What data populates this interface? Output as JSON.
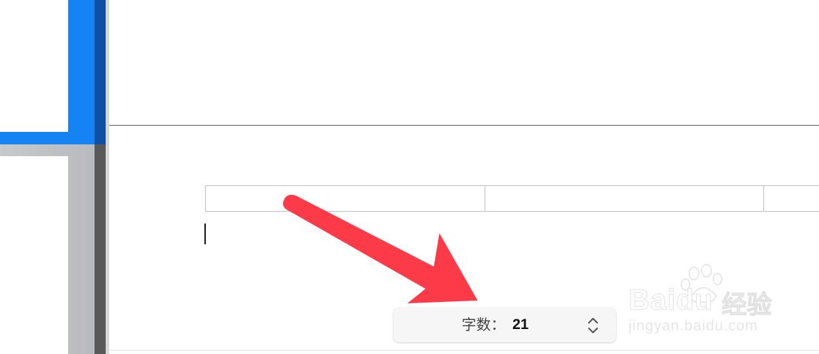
{
  "word_count": {
    "label": "字数：",
    "value": "21",
    "stepper_icon": "chevron-up-down-icon"
  },
  "watermark": {
    "brand": "Baidu",
    "cn": "经验",
    "url": "jingyan.baidu.com"
  },
  "colors": {
    "annotation_arrow": "#fc3a48",
    "sidebar_selected": "#1683f5"
  }
}
